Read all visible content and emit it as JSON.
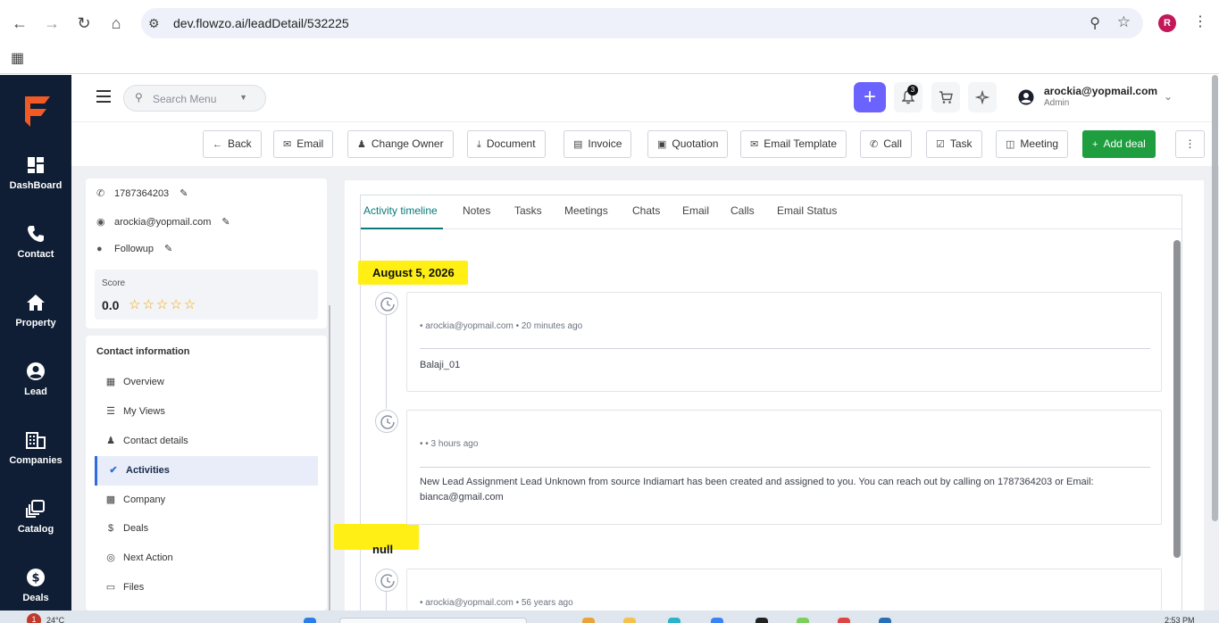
{
  "browser": {
    "url": "dev.flowzo.ai/leadDetail/532225",
    "profile_initial": "R"
  },
  "sidebar": {
    "items": [
      {
        "label": "DashBoard",
        "icon": "dashboard-icon"
      },
      {
        "label": "Contact",
        "icon": "phone-icon"
      },
      {
        "label": "Property",
        "icon": "home-icon"
      },
      {
        "label": "Lead",
        "icon": "user-circle-icon"
      },
      {
        "label": "Companies",
        "icon": "building-icon"
      },
      {
        "label": "Catalog",
        "icon": "catalog-icon"
      },
      {
        "label": "Deals",
        "icon": "dollar-icon"
      }
    ]
  },
  "header": {
    "search_placeholder": "Search Menu",
    "notification_count": "3",
    "user_email": "arockia@yopmail.com",
    "user_role": "Admin"
  },
  "toolbar": {
    "back": "Back",
    "email": "Email",
    "change_owner": "Change Owner",
    "document": "Document",
    "invoice": "Invoice",
    "quotation": "Quotation",
    "email_template": "Email Template",
    "call": "Call",
    "task": "Task",
    "meeting": "Meeting",
    "add_deal": "Add deal"
  },
  "contact": {
    "phone": "1787364203",
    "email": "arockia@yopmail.com",
    "status": "Followup",
    "score_label": "Score",
    "score_value": "0.0",
    "rating_stars": 0
  },
  "contact_nav": {
    "title": "Contact information",
    "items": [
      {
        "label": "Overview",
        "icon": "grid-icon"
      },
      {
        "label": "My Views",
        "icon": "views-icon"
      },
      {
        "label": "Contact details",
        "icon": "person-icon"
      },
      {
        "label": "Activities",
        "icon": "check-circle-icon"
      },
      {
        "label": "Company",
        "icon": "building-icon"
      },
      {
        "label": "Deals",
        "icon": "dollar-icon"
      },
      {
        "label": "Next Action",
        "icon": "location-icon"
      },
      {
        "label": "Files",
        "icon": "folder-icon"
      }
    ]
  },
  "tabs": [
    "Activity timeline",
    "Notes",
    "Tasks",
    "Meetings",
    "Chats",
    "Email",
    "Calls",
    "Email Status"
  ],
  "timeline": {
    "groups": [
      {
        "date": "August 5, 2026",
        "entries": [
          {
            "meta": "• arockia@yopmail.com • 20 minutes ago",
            "body": "Balaji_01"
          },
          {
            "meta": "• • 3 hours ago",
            "body": "New Lead Assignment Lead Unknown from source Indiamart has been created and assigned to you. You can reach out by calling on 1787364203 or Email: bianca@gmail.com"
          }
        ]
      },
      {
        "date": "null",
        "entries": [
          {
            "meta": "• arockia@yopmail.com • 56 years ago",
            "body": ""
          }
        ]
      }
    ]
  },
  "taskbar": {
    "badge": "1",
    "temperature": "24°C",
    "time": "2:53 PM"
  },
  "colors": {
    "sidebar_bg": "#0f1e35",
    "brand_orange": "#f15a24",
    "accent_purple": "#6c63ff",
    "add_green": "#1e9e3e",
    "tab_active": "#0a7a7a",
    "highlight": "#ffef14"
  }
}
